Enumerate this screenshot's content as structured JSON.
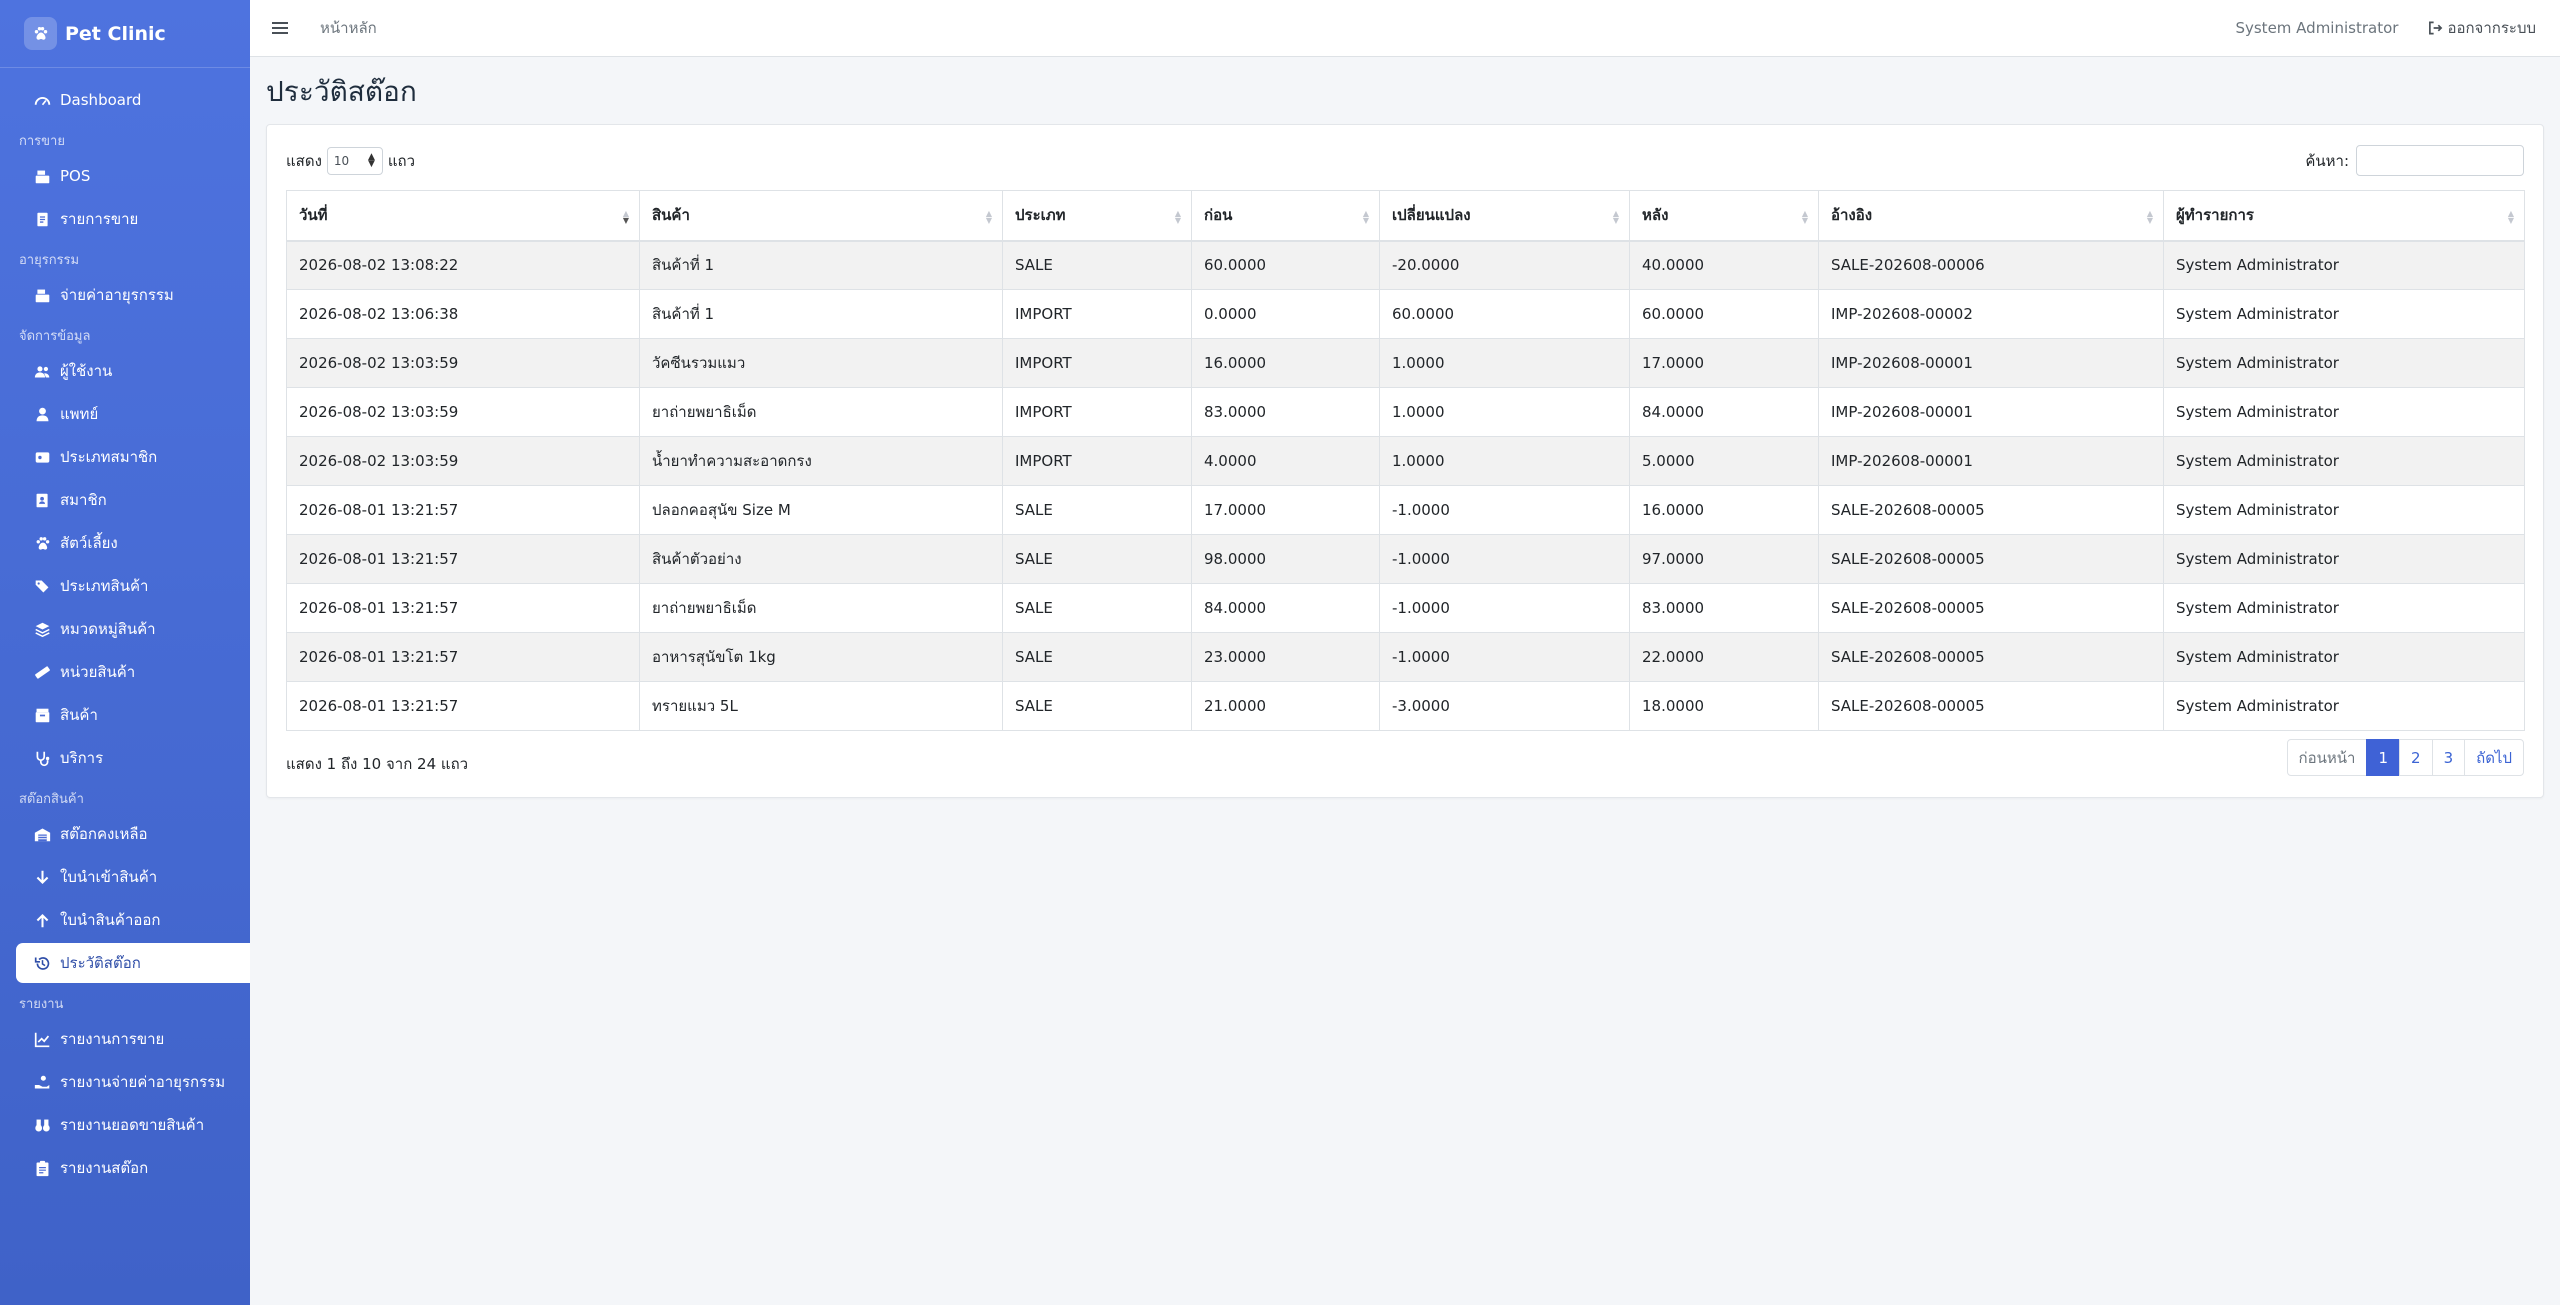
{
  "brand": {
    "name": "Pet Clinic",
    "logo_icon": "paw-icon"
  },
  "sidebar": {
    "sections": [
      {
        "title": "",
        "items": [
          {
            "label": "Dashboard",
            "icon": "gauge-icon"
          }
        ]
      },
      {
        "title": "การขาย",
        "items": [
          {
            "label": "POS",
            "icon": "cash-register-icon"
          },
          {
            "label": "รายการขาย",
            "icon": "receipt-icon"
          }
        ]
      },
      {
        "title": "อายุรกรรม",
        "items": [
          {
            "label": "จ่ายค่าอายุรกรรม",
            "icon": "cash-register-icon"
          }
        ]
      },
      {
        "title": "จัดการข้อมูล",
        "items": [
          {
            "label": "ผู้ใช้งาน",
            "icon": "users-icon"
          },
          {
            "label": "แพทย์",
            "icon": "doctor-icon"
          },
          {
            "label": "ประเภทสมาชิก",
            "icon": "id-card-icon"
          },
          {
            "label": "สมาชิก",
            "icon": "address-book-icon"
          },
          {
            "label": "สัตว์เลี้ยง",
            "icon": "paw-icon"
          },
          {
            "label": "ประเภทสินค้า",
            "icon": "tags-icon"
          },
          {
            "label": "หมวดหมู่สินค้า",
            "icon": "layers-icon"
          },
          {
            "label": "หน่วยสินค้า",
            "icon": "ruler-icon"
          },
          {
            "label": "สินค้า",
            "icon": "box-icon"
          },
          {
            "label": "บริการ",
            "icon": "stethoscope-icon"
          }
        ]
      },
      {
        "title": "สต๊อกสินค้า",
        "items": [
          {
            "label": "สต๊อกคงเหลือ",
            "icon": "warehouse-icon"
          },
          {
            "label": "ใบนำเข้าสินค้า",
            "icon": "arrow-down-icon"
          },
          {
            "label": "ใบนำสินค้าออก",
            "icon": "arrow-up-icon"
          },
          {
            "label": "ประวัติสต๊อก",
            "icon": "history-icon",
            "active": true
          }
        ]
      },
      {
        "title": "รายงาน",
        "items": [
          {
            "label": "รายงานการขาย",
            "icon": "chart-line-icon"
          },
          {
            "label": "รายงานจ่ายค่าอายุรกรรม",
            "icon": "hand-holding-icon"
          },
          {
            "label": "รายงานยอดขายสินค้า",
            "icon": "binoculars-icon"
          },
          {
            "label": "รายงานสต๊อก",
            "icon": "clipboard-icon"
          }
        ]
      }
    ]
  },
  "topbar": {
    "breadcrumb": "หน้าหลัก",
    "user": "System Administrator",
    "logout": "ออกจากระบบ"
  },
  "page": {
    "title": "ประวัติสต๊อก"
  },
  "table_controls": {
    "show_prefix": "แสดง",
    "page_size": "10",
    "show_suffix": "แถว",
    "search_label": "ค้นหา:",
    "search_value": ""
  },
  "table": {
    "columns": [
      "วันที่",
      "สินค้า",
      "ประเภท",
      "ก่อน",
      "เปลี่ยนแปลง",
      "หลัง",
      "อ้างอิง",
      "ผู้ทำรายการ"
    ],
    "rows": [
      [
        "2026-08-02 13:08:22",
        "สินค้าที่ 1",
        "SALE",
        "60.0000",
        "-20.0000",
        "40.0000",
        "SALE-202608-00006",
        "System Administrator"
      ],
      [
        "2026-08-02 13:06:38",
        "สินค้าที่ 1",
        "IMPORT",
        "0.0000",
        "60.0000",
        "60.0000",
        "IMP-202608-00002",
        "System Administrator"
      ],
      [
        "2026-08-02 13:03:59",
        "วัคซีนรวมแมว",
        "IMPORT",
        "16.0000",
        "1.0000",
        "17.0000",
        "IMP-202608-00001",
        "System Administrator"
      ],
      [
        "2026-08-02 13:03:59",
        "ยาถ่ายพยาธิเม็ด",
        "IMPORT",
        "83.0000",
        "1.0000",
        "84.0000",
        "IMP-202608-00001",
        "System Administrator"
      ],
      [
        "2026-08-02 13:03:59",
        "น้ำยาทำความสะอาดกรง",
        "IMPORT",
        "4.0000",
        "1.0000",
        "5.0000",
        "IMP-202608-00001",
        "System Administrator"
      ],
      [
        "2026-08-01 13:21:57",
        "ปลอกคอสุนัข Size M",
        "SALE",
        "17.0000",
        "-1.0000",
        "16.0000",
        "SALE-202608-00005",
        "System Administrator"
      ],
      [
        "2026-08-01 13:21:57",
        "สินค้าตัวอย่าง",
        "SALE",
        "98.0000",
        "-1.0000",
        "97.0000",
        "SALE-202608-00005",
        "System Administrator"
      ],
      [
        "2026-08-01 13:21:57",
        "ยาถ่ายพยาธิเม็ด",
        "SALE",
        "84.0000",
        "-1.0000",
        "83.0000",
        "SALE-202608-00005",
        "System Administrator"
      ],
      [
        "2026-08-01 13:21:57",
        "อาหารสุนัขโต 1kg",
        "SALE",
        "23.0000",
        "-1.0000",
        "22.0000",
        "SALE-202608-00005",
        "System Administrator"
      ],
      [
        "2026-08-01 13:21:57",
        "ทรายแมว 5L",
        "SALE",
        "21.0000",
        "-3.0000",
        "18.0000",
        "SALE-202608-00005",
        "System Administrator"
      ]
    ]
  },
  "footer": {
    "info": "แสดง 1 ถึง 10 จาก 24 แถว"
  },
  "pagination": {
    "prev": "ก่อนหน้า",
    "pages": [
      "1",
      "2",
      "3"
    ],
    "active": "1",
    "next": "ถัดไป"
  },
  "colors": {
    "sidebar": "#4e73df",
    "accent": "#3f62d6",
    "active_text": "#2f4ea8"
  }
}
